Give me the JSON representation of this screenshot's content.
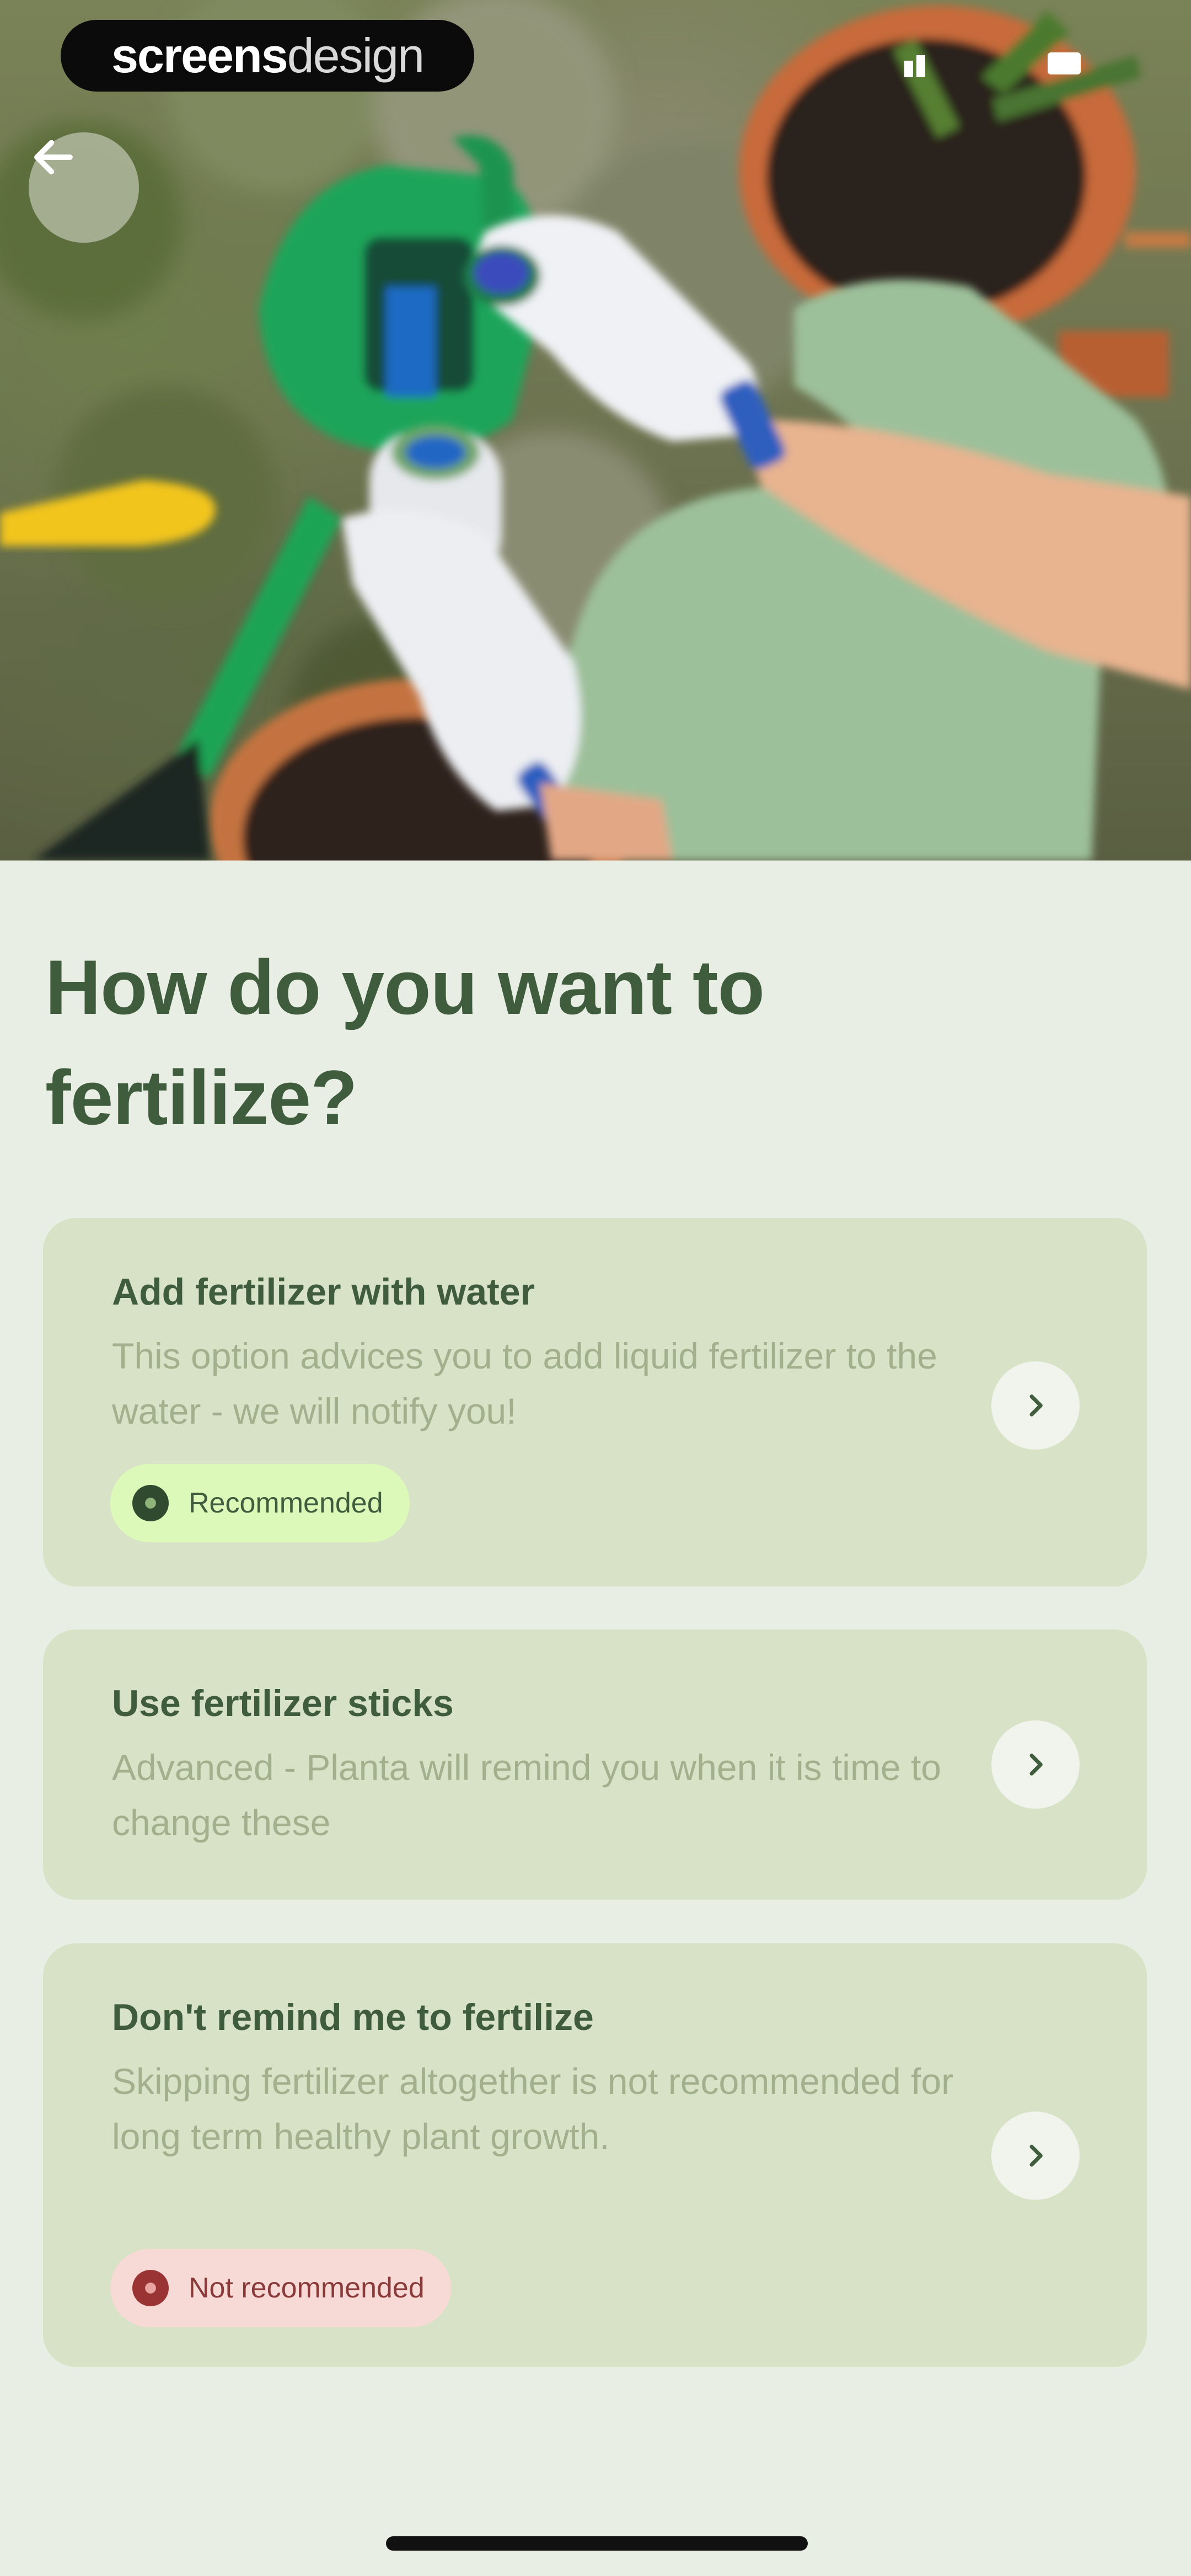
{
  "watermark": {
    "bold": "screens",
    "light": "design"
  },
  "header": {
    "back_icon": "arrow-left-icon"
  },
  "page_title": "How do you want to fertilize?",
  "options": [
    {
      "title": "Add fertilizer with water",
      "description": "This option advices you to add liquid fertilizer to the water - we will notify you!",
      "badge": "Recommended",
      "badge_type": "recommended"
    },
    {
      "title": "Use fertilizer sticks",
      "description": "Advanced - Planta will remind you when it is time to change these"
    },
    {
      "title": "Don't remind me to fertilize",
      "description": "Skipping fertilizer altogether is not recommended for long term healthy plant growth.",
      "badge": "Not recommended",
      "badge_type": "not-recommended"
    }
  ],
  "colors": {
    "background": "#e8eee4",
    "card": "#d7e2c6",
    "title": "#3f5c3d",
    "description": "#a3b08e",
    "recommended_badge": "#dcf9b9",
    "not_recommended_badge": "#f7dad6"
  }
}
